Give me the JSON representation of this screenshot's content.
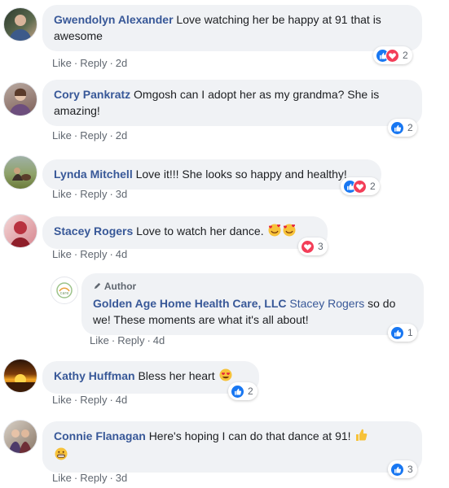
{
  "comments": [
    {
      "name": "Gwendolyn Alexander",
      "text": "Love watching her be happy at 91 that is awesome",
      "like": "Like",
      "reply": "Reply",
      "time": "2d",
      "count": "2",
      "reactions": [
        "like-icon",
        "love-icon"
      ]
    },
    {
      "name": "Cory Pankratz",
      "text": "Omgosh can I adopt her as my grandma? She is amazing!",
      "like": "Like",
      "reply": "Reply",
      "time": "2d",
      "count": "2",
      "reactions": [
        "like-icon"
      ]
    },
    {
      "name": "Lynda Mitchell",
      "text": "Love it!!! She looks so happy and healthy!",
      "like": "Like",
      "reply": "Reply",
      "time": "3d",
      "count": "2",
      "reactions": [
        "like-icon",
        "love-icon"
      ]
    },
    {
      "name": "Stacey Rogers",
      "text": "Love to watch her dance.",
      "like": "Like",
      "reply": "Reply",
      "time": "4d",
      "count": "3",
      "reactions": [
        "love-icon"
      ],
      "emojis": [
        "smiling-face-with-hearts-emoji",
        "smiling-face-with-hearts-emoji"
      ]
    },
    {
      "author_badge": "Author",
      "name": "Golden Age Home Health Care, LLC",
      "tag": "Stacey Rogers",
      "text": "so do we! These moments are what it's all about!",
      "like": "Like",
      "reply": "Reply",
      "time": "4d",
      "count": "1",
      "reactions": [
        "like-icon"
      ]
    },
    {
      "name": "Kathy Huffman",
      "text": "Bless her heart",
      "like": "Like",
      "reply": "Reply",
      "time": "4d",
      "count": "2",
      "reactions": [
        "like-icon"
      ],
      "emojis": [
        "heart-eyes-emoji"
      ]
    },
    {
      "name": "Connie Flanagan",
      "text": "Here's hoping I can do that dance at 91!",
      "like": "Like",
      "reply": "Reply",
      "time": "3d",
      "count": "3",
      "reactions": [
        "like-icon"
      ],
      "emojis": [
        "thumbs-up-emoji",
        "grinning-emoji"
      ]
    }
  ],
  "colors": {
    "name_link": "#385898",
    "bubble": "#f0f2f5",
    "like_blue": "#1877f2",
    "love_red": "#f33e58"
  }
}
